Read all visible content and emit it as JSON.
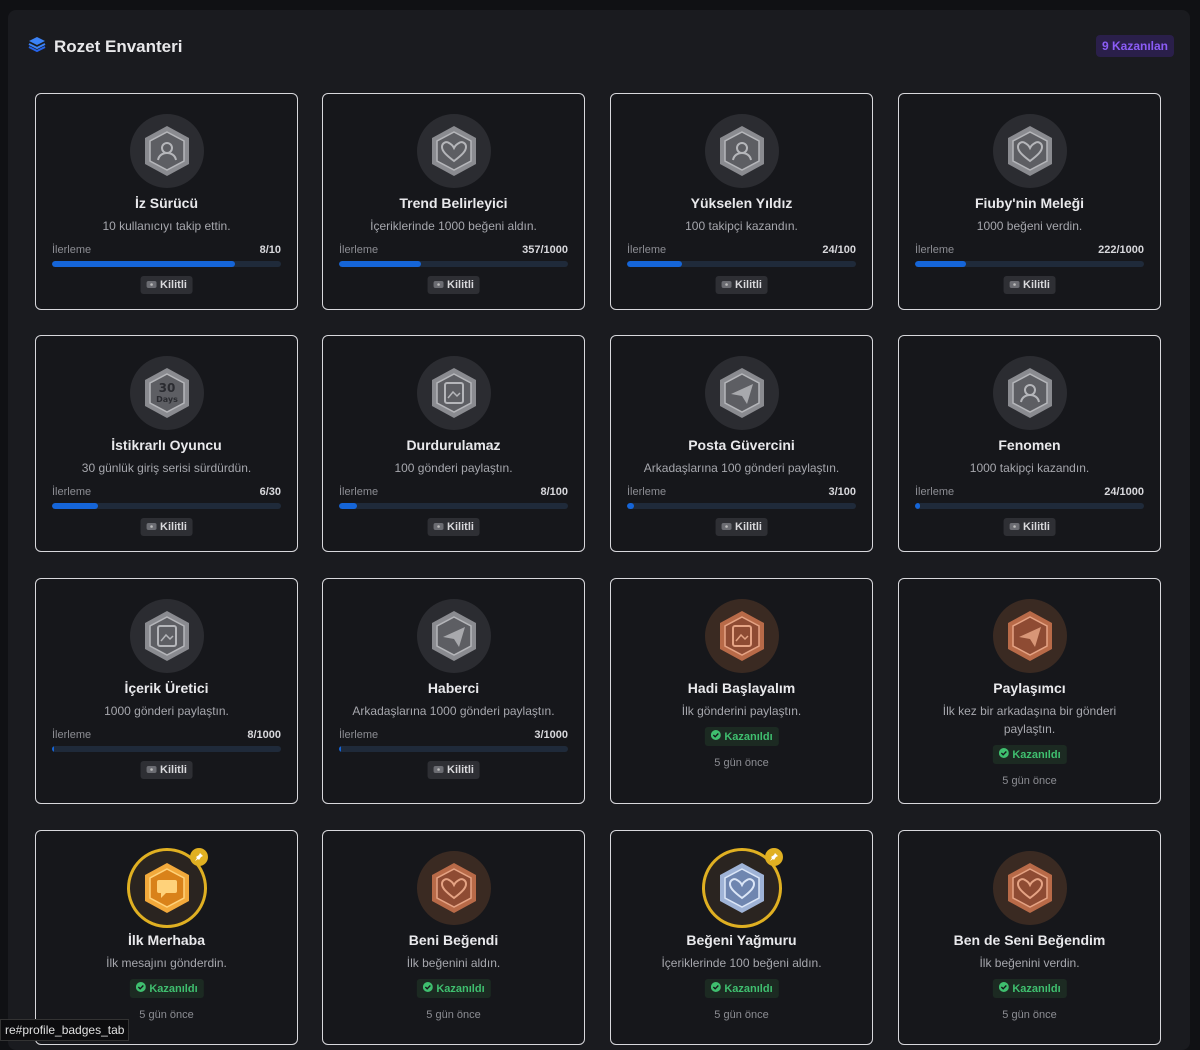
{
  "header": {
    "title": "Rozet Envanteri",
    "earned_count": "9 Kazanılan"
  },
  "labels": {
    "progress": "İlerleme",
    "locked": "Kilitli",
    "earned": "Kazanıldı"
  },
  "statusbar": {
    "text": "re#profile_badges_tab"
  },
  "colors": {
    "accent": "#1565d8",
    "earned": "#3fbf6f",
    "purple": "#8b5cf6",
    "gold": "#e0b022"
  },
  "badges": [
    {
      "title": "İz Sürücü",
      "desc": "10 kullanıcıyı takip ettin.",
      "progress_text": "8/10",
      "progress": 0.8,
      "status": "locked",
      "icon": "magnifier-users-icon"
    },
    {
      "title": "Trend Belirleyici",
      "desc": "İçeriklerinde 1000 beğeni aldın.",
      "progress_text": "357/1000",
      "progress": 0.357,
      "status": "locked",
      "icon": "heart-icon"
    },
    {
      "title": "Yükselen Yıldız",
      "desc": "100 takipçi kazandın.",
      "progress_text": "24/100",
      "progress": 0.24,
      "status": "locked",
      "icon": "group-icon"
    },
    {
      "title": "Fiuby'nin Meleği",
      "desc": "1000 beğeni verdin.",
      "progress_text": "222/1000",
      "progress": 0.222,
      "status": "locked",
      "icon": "hand-heart-icon"
    },
    {
      "title": "İstikrarlı Oyuncu",
      "desc": "30 günlük giriş serisi sürdürdün.",
      "progress_text": "6/30",
      "progress": 0.2,
      "status": "locked",
      "icon": "thirty-days-icon"
    },
    {
      "title": "Durdurulamaz",
      "desc": "100 gönderi paylaştın.",
      "progress_text": "8/100",
      "progress": 0.08,
      "status": "locked",
      "icon": "post-icon"
    },
    {
      "title": "Posta Güvercini",
      "desc": "Arkadaşlarına 100 gönderi paylaştın.",
      "progress_text": "3/100",
      "progress": 0.03,
      "status": "locked",
      "icon": "paper-plane-icon"
    },
    {
      "title": "Fenomen",
      "desc": "1000 takipçi kazandın.",
      "progress_text": "24/1000",
      "progress": 0.024,
      "status": "locked",
      "icon": "crowd-icon"
    },
    {
      "title": "İçerik Üretici",
      "desc": "1000 gönderi paylaştın.",
      "progress_text": "8/1000",
      "progress": 0.008,
      "status": "locked",
      "icon": "post-icon"
    },
    {
      "title": "Haberci",
      "desc": "Arkadaşlarına 1000 gönderi paylaştın.",
      "progress_text": "3/1000",
      "progress": 0.003,
      "status": "locked",
      "icon": "paper-plane-icon"
    },
    {
      "title": "Hadi Başlayalım",
      "desc": "İlk gönderini paylaştın.",
      "status": "earned",
      "time": "5 gün önce",
      "icon": "post-icon",
      "tier": "bronze"
    },
    {
      "title": "Paylaşımcı",
      "desc": "İlk kez bir arkadaşına bir gönderi paylaştın.",
      "status": "earned",
      "time": "5 gün önce",
      "icon": "paper-plane-icon",
      "tier": "bronze"
    },
    {
      "title": "İlk Merhaba",
      "desc": "İlk mesajını gönderdin.",
      "status": "earned",
      "time": "5 gün önce",
      "icon": "chat-icon",
      "tier": "gold",
      "pinned": true
    },
    {
      "title": "Beni Beğendi",
      "desc": "İlk beğenini aldın.",
      "status": "earned",
      "time": "5 gün önce",
      "icon": "heart-icon",
      "tier": "bronze"
    },
    {
      "title": "Beğeni Yağmuru",
      "desc": "İçeriklerinde 100 beğeni aldın.",
      "status": "earned",
      "time": "5 gün önce",
      "icon": "heart-icon",
      "tier": "silver",
      "pinned": true
    },
    {
      "title": "Ben de Seni Beğendim",
      "desc": "İlk beğenini verdin.",
      "status": "earned",
      "time": "5 gün önce",
      "icon": "hand-heart-icon",
      "tier": "bronze"
    }
  ]
}
